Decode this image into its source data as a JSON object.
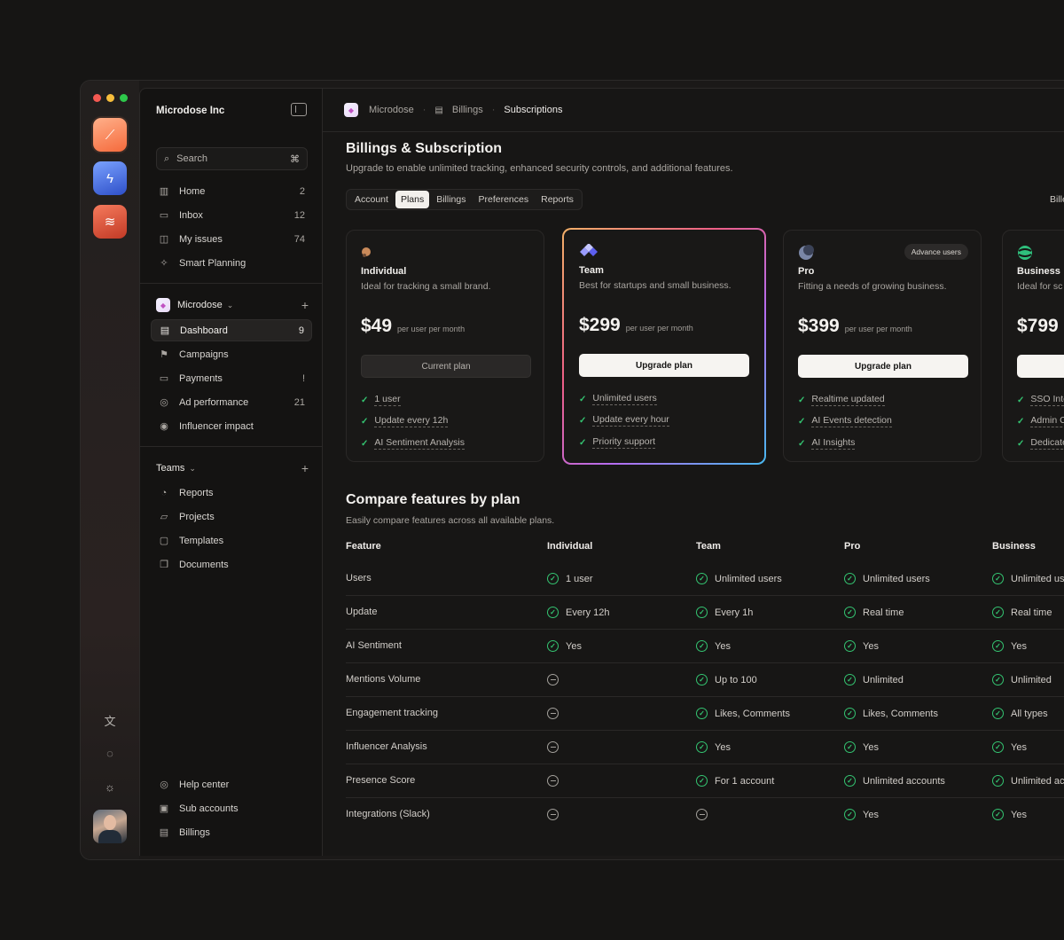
{
  "rail": {
    "traffic_colors": [
      "#f45952",
      "#f6bd3b",
      "#2ec84b"
    ],
    "apps": [
      {
        "name": "app-tile-orange",
        "colors": [
          "#ff9a6b",
          "#f56a3c"
        ]
      },
      {
        "name": "app-tile-blue",
        "colors": [
          "#5e8cf5",
          "#2e4fc8"
        ]
      },
      {
        "name": "app-tile-red",
        "colors": [
          "#f2664a",
          "#c23a26"
        ]
      }
    ],
    "icons": [
      "translate-icon",
      "lightbulb-icon",
      "sun-icon"
    ]
  },
  "sidebar": {
    "org_name": "Microdose Inc",
    "search": {
      "placeholder": "Search",
      "shortcut": "⌘"
    },
    "primary": [
      {
        "label": "Home",
        "count": "2",
        "icon": "home-icon"
      },
      {
        "label": "Inbox",
        "count": "12",
        "icon": "inbox-icon"
      },
      {
        "label": "My issues",
        "count": "74",
        "icon": "issues-icon"
      },
      {
        "label": "Smart Planning",
        "count": "",
        "icon": "sparkle-icon"
      }
    ],
    "workspace": {
      "name": "Microdose",
      "items": [
        {
          "label": "Dashboard",
          "count": "9",
          "icon": "document-icon"
        },
        {
          "label": "Campaigns",
          "count": "",
          "icon": "flag-icon"
        },
        {
          "label": "Payments",
          "count": "!",
          "icon": "card-icon"
        },
        {
          "label": "Ad performance",
          "count": "21",
          "icon": "globe-icon"
        },
        {
          "label": "Influencer impact",
          "count": "",
          "icon": "check-circle-icon"
        }
      ]
    },
    "teams": {
      "label": "Teams",
      "items": [
        {
          "label": "Reports",
          "icon": "pie-chart-icon"
        },
        {
          "label": "Projects",
          "icon": "folder-icon"
        },
        {
          "label": "Templates",
          "icon": "template-icon"
        },
        {
          "label": "Documents",
          "icon": "documents-icon"
        }
      ]
    },
    "bottom": [
      {
        "label": "Help center",
        "icon": "help-icon"
      },
      {
        "label": "Sub accounts",
        "icon": "accounts-icon"
      },
      {
        "label": "Billings",
        "icon": "billing-icon"
      }
    ]
  },
  "breadcrumb": [
    "Microdose",
    "Billings",
    "Subscriptions"
  ],
  "page": {
    "title": "Billings & Subscription",
    "subtitle": "Upgrade to enable unlimited tracking, enhanced security controls, and additional features.",
    "tabs": [
      "Account",
      "Plans",
      "Billings",
      "Preferences",
      "Reports"
    ],
    "active_tab": "Plans",
    "right_cut_text": "Bille"
  },
  "plans": [
    {
      "name": "Individual",
      "desc": "Ideal for tracking a small brand.",
      "price": "$49",
      "per": "per user per month",
      "button": "Current plan",
      "button_type": "current",
      "badge": "",
      "features": [
        "1 user",
        "Update every 12h",
        "AI Sentiment Analysis"
      ],
      "logo_color": "#c98a5a"
    },
    {
      "name": "Team",
      "desc": "Best for startups and small business.",
      "price": "$299",
      "per": "per user per month",
      "button": "Upgrade plan",
      "button_type": "upgrade",
      "badge": "",
      "features": [
        "Unlimited users",
        "Update every hour",
        "Priority support"
      ],
      "logo_color": "#7b7cf5"
    },
    {
      "name": "Pro",
      "desc": "Fitting a needs of growing business.",
      "price": "$399",
      "per": "per user per month",
      "button": "Upgrade plan",
      "button_type": "upgrade",
      "badge": "Advance users",
      "features": [
        "Realtime updated",
        "AI Events detection",
        "AI Insights"
      ],
      "logo_color": "#7a86a6"
    },
    {
      "name": "Business",
      "desc": "Ideal for sc",
      "price": "$799",
      "per": "",
      "button": "",
      "button_type": "upgrade",
      "badge": "",
      "features": [
        "SSO Inte",
        "Admin C",
        "Dedicate"
      ],
      "logo_color": "#2fbf7c"
    }
  ],
  "compare": {
    "title": "Compare features by plan",
    "subtitle": "Easily compare features across all available plans.",
    "headers": [
      "Feature",
      "Individual",
      "Team",
      "Pro",
      "Business"
    ],
    "rows": [
      {
        "feature": "Users",
        "cells": [
          {
            "ok": true,
            "t": "1 user"
          },
          {
            "ok": true,
            "t": "Unlimited users"
          },
          {
            "ok": true,
            "t": "Unlimited users"
          },
          {
            "ok": true,
            "t": "Unlimited us"
          }
        ]
      },
      {
        "feature": "Update",
        "cells": [
          {
            "ok": true,
            "t": "Every 12h"
          },
          {
            "ok": true,
            "t": "Every 1h"
          },
          {
            "ok": true,
            "t": "Real time"
          },
          {
            "ok": true,
            "t": "Real time"
          }
        ]
      },
      {
        "feature": "AI Sentiment",
        "cells": [
          {
            "ok": true,
            "t": "Yes"
          },
          {
            "ok": true,
            "t": "Yes"
          },
          {
            "ok": true,
            "t": "Yes"
          },
          {
            "ok": true,
            "t": "Yes"
          }
        ]
      },
      {
        "feature": "Mentions Volume",
        "cells": [
          {
            "ok": false,
            "t": ""
          },
          {
            "ok": true,
            "t": "Up to 100"
          },
          {
            "ok": true,
            "t": "Unlimited"
          },
          {
            "ok": true,
            "t": "Unlimited"
          }
        ]
      },
      {
        "feature": "Engagement tracking",
        "cells": [
          {
            "ok": false,
            "t": ""
          },
          {
            "ok": true,
            "t": "Likes, Comments"
          },
          {
            "ok": true,
            "t": "Likes, Comments"
          },
          {
            "ok": true,
            "t": "All types"
          }
        ]
      },
      {
        "feature": "Influencer Analysis",
        "cells": [
          {
            "ok": false,
            "t": ""
          },
          {
            "ok": true,
            "t": "Yes"
          },
          {
            "ok": true,
            "t": "Yes"
          },
          {
            "ok": true,
            "t": "Yes"
          }
        ]
      },
      {
        "feature": "Presence Score",
        "cells": [
          {
            "ok": false,
            "t": ""
          },
          {
            "ok": true,
            "t": "For 1 account"
          },
          {
            "ok": true,
            "t": "Unlimited accounts"
          },
          {
            "ok": true,
            "t": "Unlimited ac"
          }
        ]
      },
      {
        "feature": "Integrations (Slack)",
        "cells": [
          {
            "ok": false,
            "t": ""
          },
          {
            "ok": false,
            "t": ""
          },
          {
            "ok": true,
            "t": "Yes"
          },
          {
            "ok": true,
            "t": "Yes"
          }
        ]
      }
    ]
  }
}
